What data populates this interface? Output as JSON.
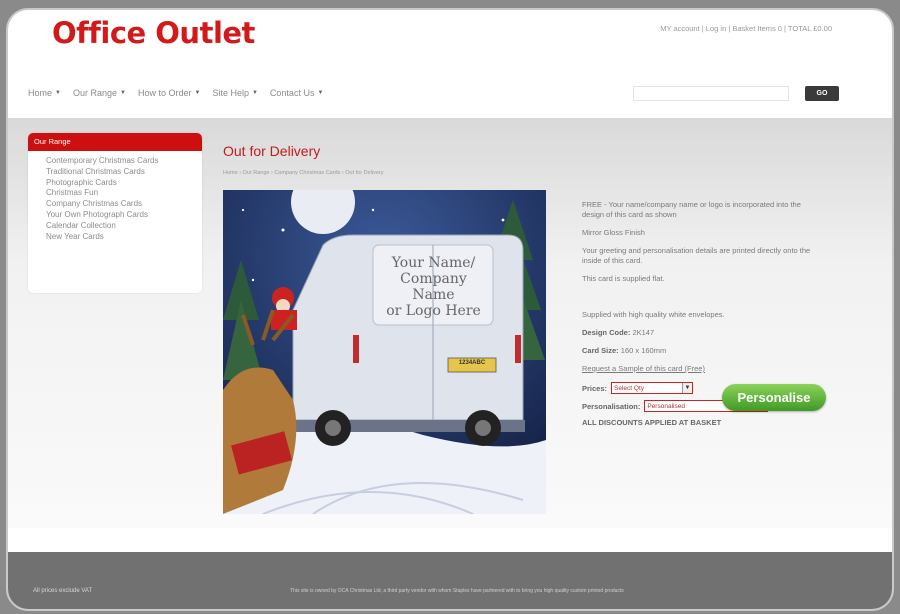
{
  "header": {
    "logo": "Office Outlet",
    "account_bar": "MY account | Log in | Basket Items 0 | TOTAL £0.00"
  },
  "nav": {
    "items": [
      {
        "label": "Home"
      },
      {
        "label": "Our Range"
      },
      {
        "label": "How to Order"
      },
      {
        "label": "Site Help"
      },
      {
        "label": "Contact Us"
      }
    ]
  },
  "search": {
    "placeholder": "",
    "go_label": "GO"
  },
  "sidebar": {
    "title": "Our Range",
    "items": [
      {
        "label": "Contemporary Christmas Cards"
      },
      {
        "label": "Traditional Christmas Cards"
      },
      {
        "label": "Photographic Cards"
      },
      {
        "label": "Christmas Fun"
      },
      {
        "label": "Company Christmas Cards"
      },
      {
        "label": "Your Own Photograph Cards"
      },
      {
        "label": "Calendar Collection"
      },
      {
        "label": "New Year Cards"
      }
    ]
  },
  "product": {
    "title": "Out for Delivery",
    "breadcrumb": "Home › Our Range › Company Christmas Cards › Out for Delivery",
    "image_text": {
      "line1": "Your Name/",
      "line2": "Company Name",
      "line3": "or Logo Here"
    },
    "plate": "1234ABC",
    "desc": {
      "p1": "FREE - Your name/company name or logo is incorporated into the design of this card as shown",
      "p2": "Mirror Gloss Finish",
      "p3": "Your greeting and personalisation details are printed directly onto the inside of this card.",
      "p4": "This card is supplied flat.",
      "p5": "Supplied with high quality white envelopes.",
      "design_code_label": "Design Code:",
      "design_code_value": "2K147",
      "card_size_label": "Card Size:",
      "card_size_value": "160 x 160mm",
      "sample_link": "Request a Sample of this card (Free)",
      "prices_label": "Prices:",
      "prices_value": "Select Qty",
      "personalisation_label": "Personalisation:",
      "personalisation_value": "Personalised",
      "discounts": "ALL DISCOUNTS APPLIED AT BASKET"
    },
    "button": "Personalise"
  },
  "footer": {
    "left": "All prices exclude VAT",
    "right": "This site is owned by OCA Christmas Ltd, a third party vendor with whom Staples have partnered with to bring you high quality custom printed products"
  }
}
